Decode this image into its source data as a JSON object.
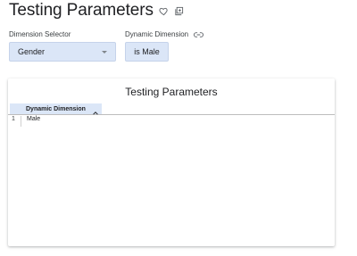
{
  "header": {
    "title": "Testing Parameters",
    "favorite_icon": "heart-outline-icon",
    "copy_icon": "copy-dashboard-icon"
  },
  "filters": {
    "dimension_selector": {
      "label": "Dimension Selector",
      "value": "Gender"
    },
    "dynamic_dimension": {
      "label": "Dynamic Dimension",
      "link_icon": "link-icon",
      "value": "is Male"
    }
  },
  "tile": {
    "title": "Testing Parameters",
    "columns": [
      "Dynamic Dimension"
    ],
    "sort_icon": "chevron-up-icon",
    "rows": [
      {
        "num": "1",
        "value": "Male"
      }
    ]
  },
  "colors": {
    "accent_fill": "#dbe6f7",
    "text": "#202124"
  }
}
